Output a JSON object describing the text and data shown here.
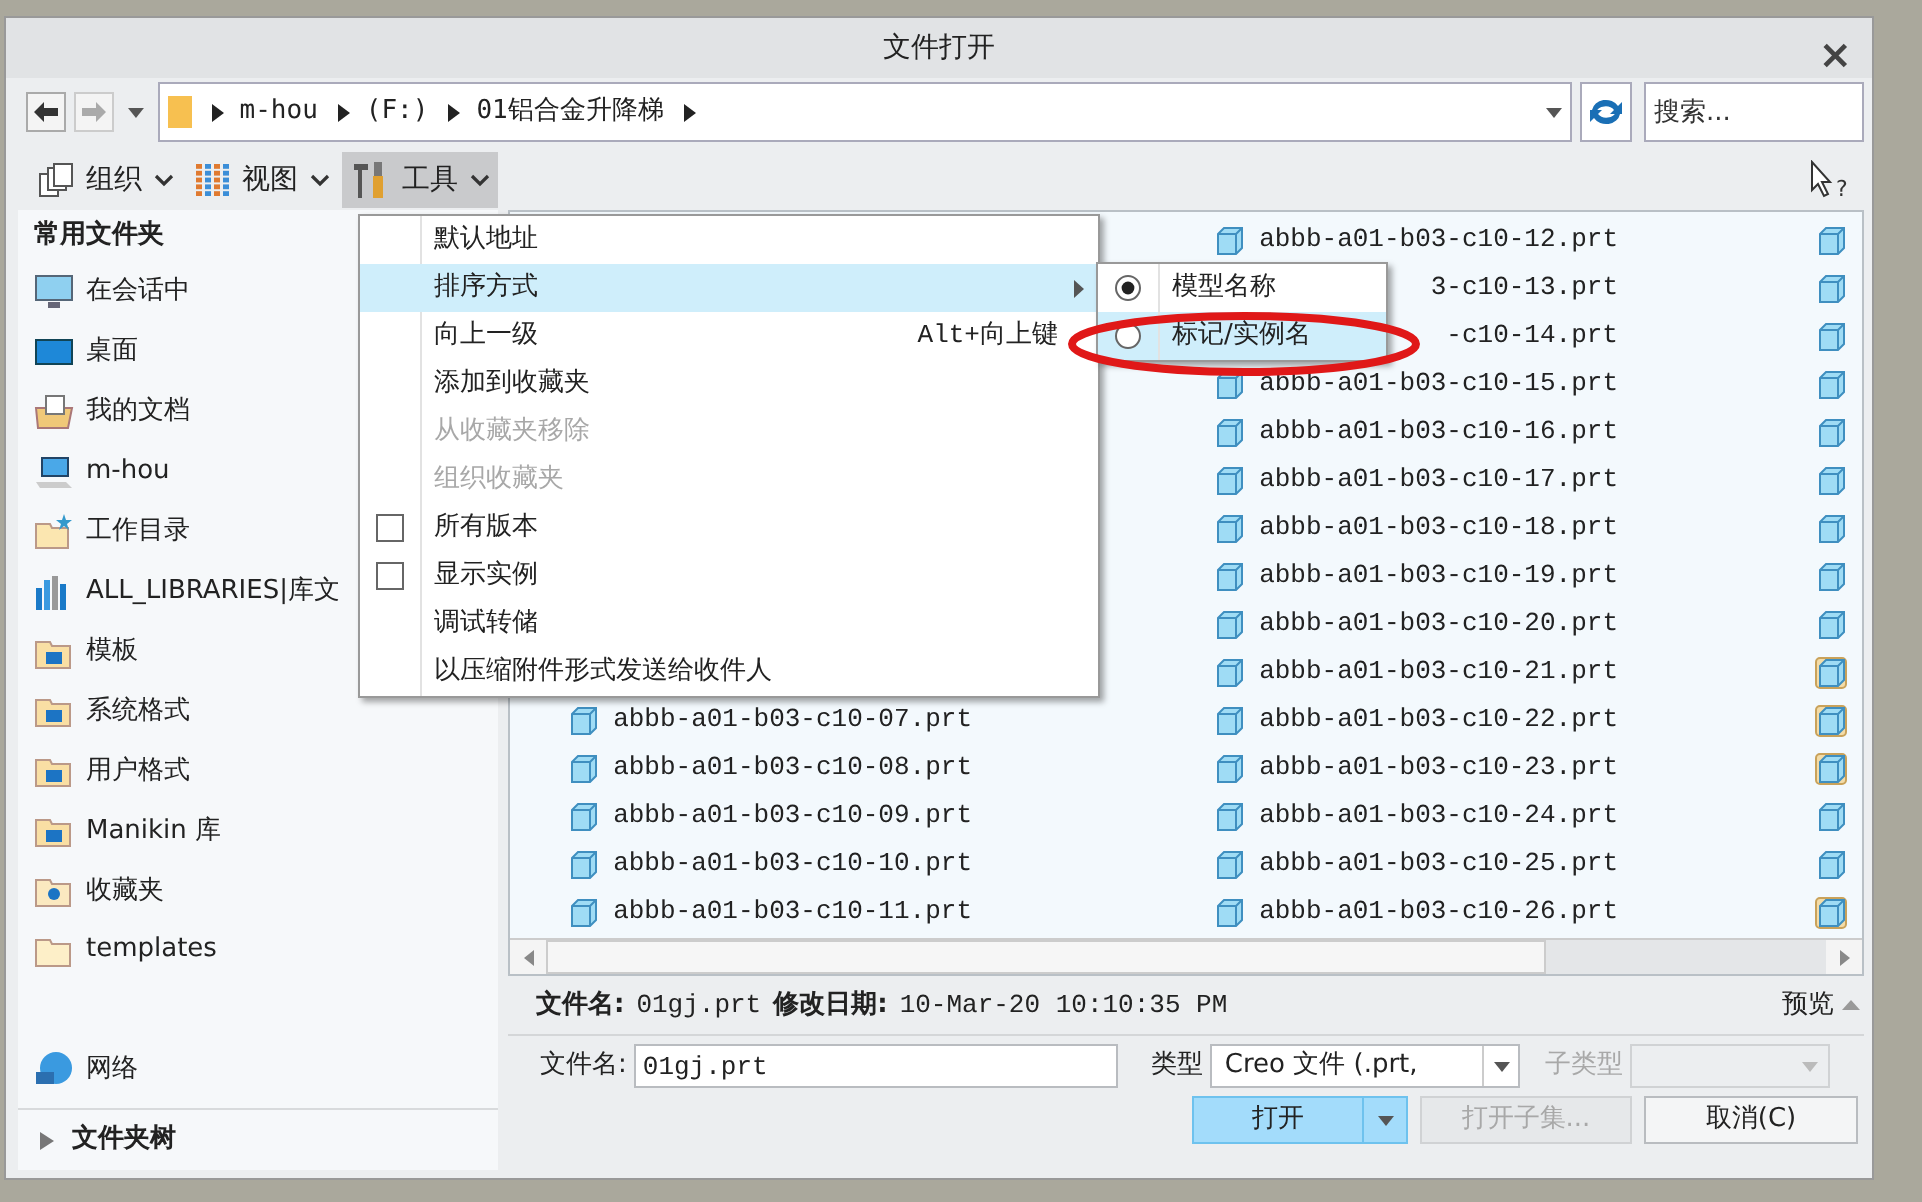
{
  "window": {
    "title": "文件打开",
    "close": "×"
  },
  "address": {
    "segments": [
      "m-hou",
      "(F:)",
      "01铝合金升降梯"
    ]
  },
  "search": {
    "placeholder": "搜索..."
  },
  "help": "?",
  "toolbar": [
    {
      "label": "组织",
      "kind": "organize",
      "selected": false
    },
    {
      "label": "视图",
      "kind": "view",
      "selected": false
    },
    {
      "label": "工具",
      "kind": "tools",
      "selected": true
    }
  ],
  "sidebar": {
    "header": "常用文件夹",
    "items": [
      {
        "label": "在会话中",
        "kind": "monitor"
      },
      {
        "label": "桌面",
        "kind": "desktop"
      },
      {
        "label": "我的文档",
        "kind": "documents"
      },
      {
        "label": "m-hou",
        "kind": "computer"
      },
      {
        "label": "工作目录",
        "kind": "workdir"
      },
      {
        "label": "ALL_LIBRARIES|库文",
        "kind": "library"
      },
      {
        "label": "模板",
        "kind": "listfolder"
      },
      {
        "label": "系统格式",
        "kind": "listfolder"
      },
      {
        "label": "用户格式",
        "kind": "listfolder"
      },
      {
        "label": "Manikin 库",
        "kind": "listfolder"
      },
      {
        "label": "收藏夹",
        "kind": "favorites"
      },
      {
        "label": "templates",
        "kind": "folder"
      }
    ],
    "network": "网络",
    "folder_tree": "文件夹树",
    "folder_tree_expanded": false
  },
  "files": {
    "column_1": [
      {
        "name": "abbb-a01-b03-c10-07.prt",
        "kind": "part"
      },
      {
        "name": "abbb-a01-b03-c10-08.prt",
        "kind": "part"
      },
      {
        "name": "abbb-a01-b03-c10-09.prt",
        "kind": "part"
      },
      {
        "name": "abbb-a01-b03-c10-10.prt",
        "kind": "part"
      },
      {
        "name": "abbb-a01-b03-c10-11.prt",
        "kind": "part"
      }
    ],
    "column_2": [
      {
        "name": "abbb-a01-b03-c10-12.prt",
        "kind": "part"
      },
      {
        "name": "3-c10-13.prt",
        "kind": "cut"
      },
      {
        "name": "-c10-14.prt",
        "kind": "cut"
      },
      {
        "name": "abbb-a01-b03-c10-15.prt",
        "kind": "part"
      },
      {
        "name": "abbb-a01-b03-c10-16.prt",
        "kind": "part"
      },
      {
        "name": "abbb-a01-b03-c10-17.prt",
        "kind": "part"
      },
      {
        "name": "abbb-a01-b03-c10-18.prt",
        "kind": "part"
      },
      {
        "name": "abbb-a01-b03-c10-19.prt",
        "kind": "part"
      },
      {
        "name": "abbb-a01-b03-c10-20.prt",
        "kind": "part"
      },
      {
        "name": "abbb-a01-b03-c10-21.prt",
        "kind": "part"
      },
      {
        "name": "abbb-a01-b03-c10-22.prt",
        "kind": "part"
      },
      {
        "name": "abbb-a01-b03-c10-23.prt",
        "kind": "part"
      },
      {
        "name": "abbb-a01-b03-c10-24.prt",
        "kind": "part"
      },
      {
        "name": "abbb-a01-b03-c10-25.prt",
        "kind": "part"
      },
      {
        "name": "abbb-a01-b03-c10-26.prt",
        "kind": "part"
      }
    ],
    "column_3": [
      {
        "kind": "part"
      },
      {
        "kind": "part"
      },
      {
        "kind": "part"
      },
      {
        "kind": "part"
      },
      {
        "kind": "part"
      },
      {
        "kind": "part"
      },
      {
        "kind": "part"
      },
      {
        "kind": "part"
      },
      {
        "kind": "part"
      },
      {
        "kind": "instance"
      },
      {
        "kind": "instance"
      },
      {
        "kind": "instance"
      },
      {
        "kind": "part"
      },
      {
        "kind": "part"
      },
      {
        "kind": "instance"
      }
    ]
  },
  "tools_menu": [
    {
      "label": "默认地址",
      "kind": "item",
      "disabled": false,
      "highlighted": false
    },
    {
      "label": "排序方式",
      "kind": "submenu",
      "disabled": false,
      "highlighted": true
    },
    {
      "label": "向上一级",
      "kind": "item",
      "shortcut": "Alt+向上键",
      "disabled": false,
      "highlighted": false
    },
    {
      "label": "添加到收藏夹",
      "kind": "item",
      "disabled": false,
      "highlighted": false
    },
    {
      "label": "从收藏夹移除",
      "kind": "item",
      "disabled": true,
      "highlighted": false
    },
    {
      "label": "组织收藏夹",
      "kind": "item",
      "disabled": true,
      "highlighted": false
    },
    {
      "label": "所有版本",
      "kind": "check",
      "checked": false,
      "disabled": false,
      "highlighted": false
    },
    {
      "label": "显示实例",
      "kind": "check",
      "checked": false,
      "disabled": false,
      "highlighted": false
    },
    {
      "label": "调试转储",
      "kind": "item",
      "disabled": false,
      "highlighted": false
    },
    {
      "label": "以压缩附件形式发送给收件人",
      "kind": "item",
      "disabled": false,
      "highlighted": false
    }
  ],
  "sort_submenu": [
    {
      "label": "模型名称",
      "selected": true,
      "highlighted": false
    },
    {
      "label": "标记/实例名",
      "selected": false,
      "highlighted": true
    }
  ],
  "info": {
    "name_label": "文件名:",
    "name": "01gj.prt",
    "date_label": "修改日期:",
    "date": "10-Mar-20 10:10:35 PM",
    "preview": "预览"
  },
  "form": {
    "name_label": "文件名:",
    "name_value": "01gj.prt",
    "type_label": "类型",
    "type_value": "Creo 文件 (.prt,",
    "subtype_label": "子类型",
    "subtype_disabled": true
  },
  "buttons": {
    "open": "打开",
    "open_subset": "打开子集...",
    "open_subset_disabled": true,
    "cancel": "取消(C)"
  }
}
